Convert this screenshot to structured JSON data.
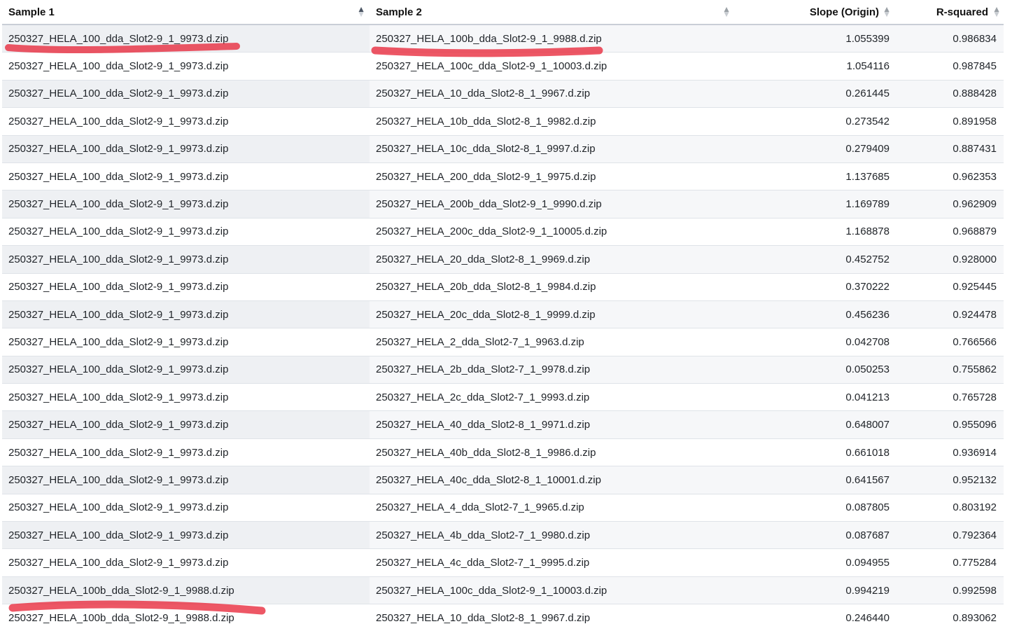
{
  "columns": {
    "sample1": "Sample 1",
    "sample2": "Sample 2",
    "slope": "Slope (Origin)",
    "rsquared": "R-squared"
  },
  "sort_state": {
    "sample1": "ascending",
    "sample2": "none",
    "slope": "none",
    "rsquared": "none"
  },
  "accent_colors": {
    "highlight_marker": "#e8283a",
    "header_border": "#c9ced6"
  },
  "rows": [
    {
      "sample1": "250327_HELA_100_dda_Slot2-9_1_9973.d.zip",
      "sample2": "250327_HELA_100b_dda_Slot2-9_1_9988.d.zip",
      "slope": "1.055399",
      "rsquared": "0.986834"
    },
    {
      "sample1": "250327_HELA_100_dda_Slot2-9_1_9973.d.zip",
      "sample2": "250327_HELA_100c_dda_Slot2-9_1_10003.d.zip",
      "slope": "1.054116",
      "rsquared": "0.987845"
    },
    {
      "sample1": "250327_HELA_100_dda_Slot2-9_1_9973.d.zip",
      "sample2": "250327_HELA_10_dda_Slot2-8_1_9967.d.zip",
      "slope": "0.261445",
      "rsquared": "0.888428"
    },
    {
      "sample1": "250327_HELA_100_dda_Slot2-9_1_9973.d.zip",
      "sample2": "250327_HELA_10b_dda_Slot2-8_1_9982.d.zip",
      "slope": "0.273542",
      "rsquared": "0.891958"
    },
    {
      "sample1": "250327_HELA_100_dda_Slot2-9_1_9973.d.zip",
      "sample2": "250327_HELA_10c_dda_Slot2-8_1_9997.d.zip",
      "slope": "0.279409",
      "rsquared": "0.887431"
    },
    {
      "sample1": "250327_HELA_100_dda_Slot2-9_1_9973.d.zip",
      "sample2": "250327_HELA_200_dda_Slot2-9_1_9975.d.zip",
      "slope": "1.137685",
      "rsquared": "0.962353"
    },
    {
      "sample1": "250327_HELA_100_dda_Slot2-9_1_9973.d.zip",
      "sample2": "250327_HELA_200b_dda_Slot2-9_1_9990.d.zip",
      "slope": "1.169789",
      "rsquared": "0.962909"
    },
    {
      "sample1": "250327_HELA_100_dda_Slot2-9_1_9973.d.zip",
      "sample2": "250327_HELA_200c_dda_Slot2-9_1_10005.d.zip",
      "slope": "1.168878",
      "rsquared": "0.968879"
    },
    {
      "sample1": "250327_HELA_100_dda_Slot2-9_1_9973.d.zip",
      "sample2": "250327_HELA_20_dda_Slot2-8_1_9969.d.zip",
      "slope": "0.452752",
      "rsquared": "0.928000"
    },
    {
      "sample1": "250327_HELA_100_dda_Slot2-9_1_9973.d.zip",
      "sample2": "250327_HELA_20b_dda_Slot2-8_1_9984.d.zip",
      "slope": "0.370222",
      "rsquared": "0.925445"
    },
    {
      "sample1": "250327_HELA_100_dda_Slot2-9_1_9973.d.zip",
      "sample2": "250327_HELA_20c_dda_Slot2-8_1_9999.d.zip",
      "slope": "0.456236",
      "rsquared": "0.924478"
    },
    {
      "sample1": "250327_HELA_100_dda_Slot2-9_1_9973.d.zip",
      "sample2": "250327_HELA_2_dda_Slot2-7_1_9963.d.zip",
      "slope": "0.042708",
      "rsquared": "0.766566"
    },
    {
      "sample1": "250327_HELA_100_dda_Slot2-9_1_9973.d.zip",
      "sample2": "250327_HELA_2b_dda_Slot2-7_1_9978.d.zip",
      "slope": "0.050253",
      "rsquared": "0.755862"
    },
    {
      "sample1": "250327_HELA_100_dda_Slot2-9_1_9973.d.zip",
      "sample2": "250327_HELA_2c_dda_Slot2-7_1_9993.d.zip",
      "slope": "0.041213",
      "rsquared": "0.765728"
    },
    {
      "sample1": "250327_HELA_100_dda_Slot2-9_1_9973.d.zip",
      "sample2": "250327_HELA_40_dda_Slot2-8_1_9971.d.zip",
      "slope": "0.648007",
      "rsquared": "0.955096"
    },
    {
      "sample1": "250327_HELA_100_dda_Slot2-9_1_9973.d.zip",
      "sample2": "250327_HELA_40b_dda_Slot2-8_1_9986.d.zip",
      "slope": "0.661018",
      "rsquared": "0.936914"
    },
    {
      "sample1": "250327_HELA_100_dda_Slot2-9_1_9973.d.zip",
      "sample2": "250327_HELA_40c_dda_Slot2-8_1_10001.d.zip",
      "slope": "0.641567",
      "rsquared": "0.952132"
    },
    {
      "sample1": "250327_HELA_100_dda_Slot2-9_1_9973.d.zip",
      "sample2": "250327_HELA_4_dda_Slot2-7_1_9965.d.zip",
      "slope": "0.087805",
      "rsquared": "0.803192"
    },
    {
      "sample1": "250327_HELA_100_dda_Slot2-9_1_9973.d.zip",
      "sample2": "250327_HELA_4b_dda_Slot2-7_1_9980.d.zip",
      "slope": "0.087687",
      "rsquared": "0.792364"
    },
    {
      "sample1": "250327_HELA_100_dda_Slot2-9_1_9973.d.zip",
      "sample2": "250327_HELA_4c_dda_Slot2-7_1_9995.d.zip",
      "slope": "0.094955",
      "rsquared": "0.775284"
    },
    {
      "sample1": "250327_HELA_100b_dda_Slot2-9_1_9988.d.zip",
      "sample2": "250327_HELA_100c_dda_Slot2-9_1_10003.d.zip",
      "slope": "0.994219",
      "rsquared": "0.992598"
    },
    {
      "sample1": "250327_HELA_100b_dda_Slot2-9_1_9988.d.zip",
      "sample2": "250327_HELA_10_dda_Slot2-8_1_9967.d.zip",
      "slope": "0.246440",
      "rsquared": "0.893062"
    }
  ]
}
